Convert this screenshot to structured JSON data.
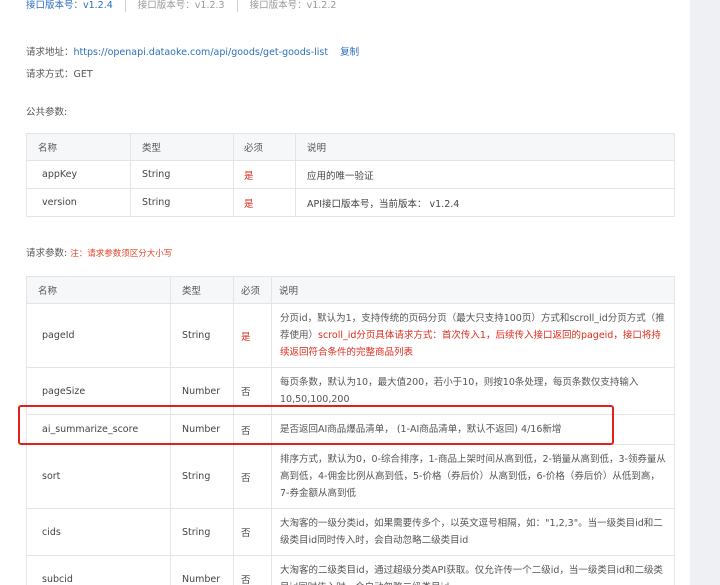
{
  "versions": [
    {
      "label": "接口版本号：v1.2.4",
      "active": true
    },
    {
      "label": "接口版本号：v1.2.3",
      "active": false
    },
    {
      "label": "接口版本号：v1.2.2",
      "active": false
    }
  ],
  "request": {
    "url_label": "请求地址：",
    "url": "https://openapi.dataoke.com/api/goods/get-goods-list",
    "copy_label": "复制",
    "method": "请求方式：GET"
  },
  "public_params": {
    "title": "公共参数:",
    "headers": [
      "名称",
      "类型",
      "必须",
      "说明"
    ],
    "rows": [
      {
        "name": "appKey",
        "type": "String",
        "required": "是",
        "desc": "应用的唯一验证"
      },
      {
        "name": "version",
        "type": "String",
        "required": "是",
        "desc": "API接口版本号，当前版本： v1.2.4"
      }
    ]
  },
  "request_params": {
    "title": "请求参数:",
    "note": "注：请求参数须区分大小写",
    "headers": [
      "名称",
      "类型",
      "必须",
      "说明"
    ],
    "rows": [
      {
        "name": "pageId",
        "type": "String",
        "required": "是",
        "desc_normal_1": "分页id，默认为1，支持传统的页码分页（最大只支持100页）方式和scroll_id分页方式（推荐使用）",
        "desc_red": "scroll_id分页具体请求方式：首次传入1，后续传入接口返回的pageid，接口将持续返回符合条件的完整商品列表"
      },
      {
        "name": "pageSize",
        "type": "Number",
        "required": "否",
        "desc": "每页条数，默认为10，最大值200，若小于10，则按10条处理，每页条数仅支持输入10,50,100,200"
      },
      {
        "name": "ai_summarize_score",
        "type": "Number",
        "required": "否",
        "desc": "是否返回AI商品爆品清单， (1-AI商品清单，默认不返回) 4/16新增"
      },
      {
        "name": "sort",
        "type": "String",
        "required": "否",
        "desc": "排序方式，默认为0，0-综合排序，1-商品上架时间从高到低，2-销量从高到低，3-领券量从高到低，4-佣金比例从高到低，5-价格（券后价）从高到低，6-价格（券后价）从低到高，7-券金额从高到低"
      },
      {
        "name": "cids",
        "type": "String",
        "required": "否",
        "desc": "大淘客的一级分类id，如果需要传多个，以英文逗号相隔，如：\"1,2,3\"。当一级类目id和二级类目id同时传入时，会自动忽略二级类目id"
      },
      {
        "name": "subcid",
        "type": "Number",
        "required": "否",
        "desc": "大淘客的二级类目id，通过超级分类API获取。仅允许传一个二级id，当一级类目id和二级类目id同时传入时，会自动忽略二级类目id"
      }
    ]
  },
  "colors": {
    "accent": "#2b6ec2",
    "required": "#e02b1d",
    "highlight": "#e0201a"
  }
}
